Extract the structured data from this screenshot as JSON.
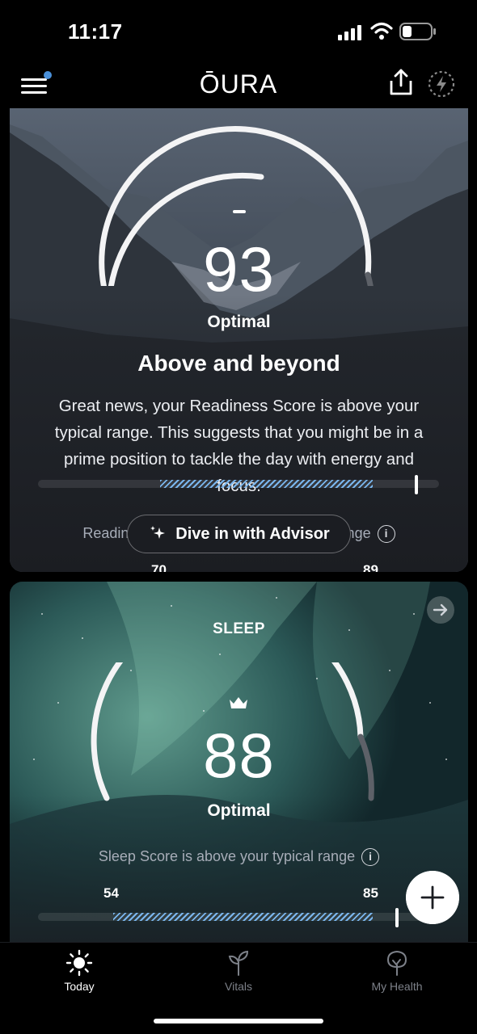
{
  "status_bar": {
    "time": "11:17"
  },
  "header": {
    "brand": "ŌURA",
    "menu_has_notification": true
  },
  "readiness": {
    "score": "93",
    "score_label": "Optimal",
    "headline": "Above and beyond",
    "body": "Great news, your Readiness Score is above your typical range. This suggests that you might be in a prime position to tackle the day with energy and focus.",
    "range_caption": "Readiness Score is above your typical range",
    "range_low": "70",
    "range_high": "89",
    "advisor_label": "Dive in with Advisor"
  },
  "sleep": {
    "title": "SLEEP",
    "score": "88",
    "score_label": "Optimal",
    "range_caption": "Sleep Score is above your typical range",
    "range_low": "54",
    "range_high": "85"
  },
  "tabs": [
    {
      "label": "Today",
      "active": true
    },
    {
      "label": "Vitals",
      "active": false
    },
    {
      "label": "My Health",
      "active": false
    }
  ],
  "colors": {
    "accent": "#7ab6ee",
    "card": "#1b1d22",
    "notification_dot": "#4a90d9"
  }
}
